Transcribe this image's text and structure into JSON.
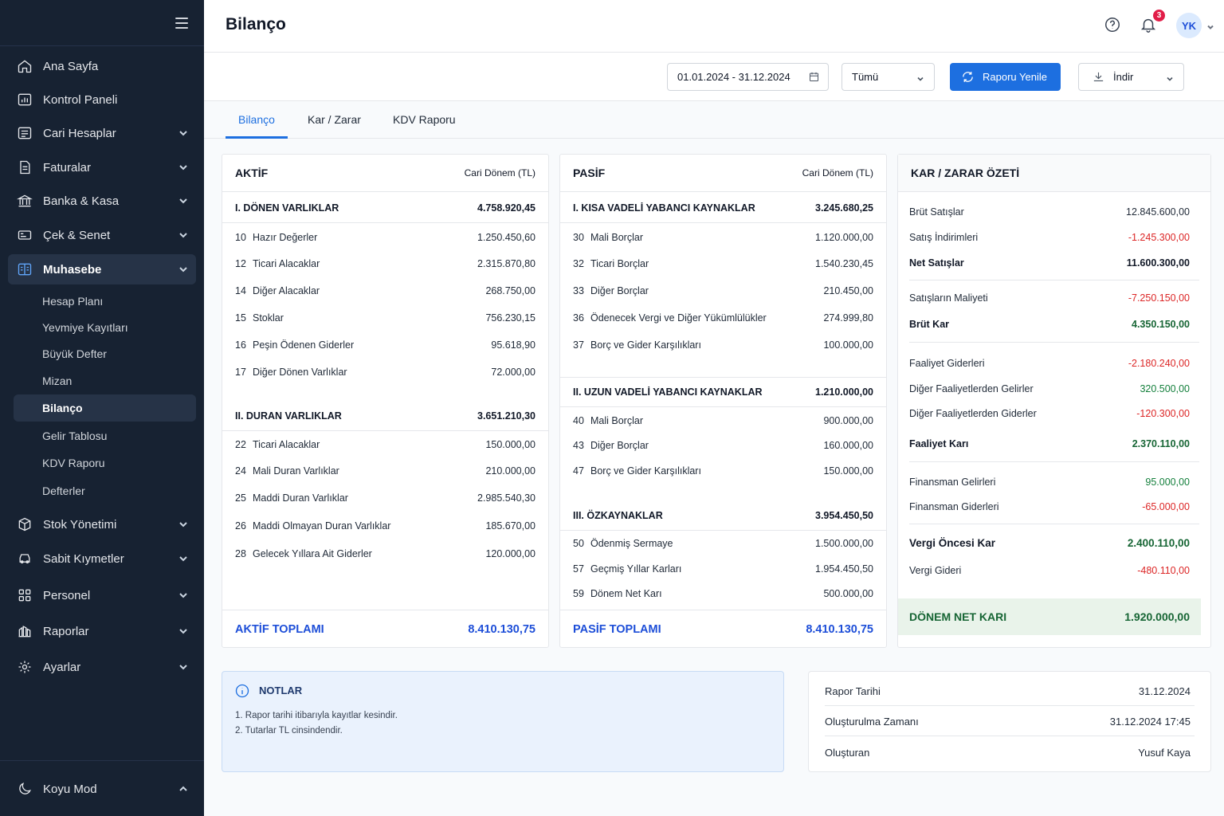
{
  "sidebar": {
    "items": [
      {
        "label": "Ana Sayfa",
        "icon": "home-icon"
      },
      {
        "label": "Kontrol Paneli",
        "icon": "dashboard-icon"
      },
      {
        "label": "Cari Hesaplar",
        "icon": "accounts-icon"
      },
      {
        "label": "Faturalar",
        "icon": "invoice-icon"
      },
      {
        "label": "Banka & Kasa",
        "icon": "bank-icon"
      },
      {
        "label": "Çek & Senet",
        "icon": "check-icon"
      },
      {
        "label": "Muhasebe",
        "icon": "ledger-icon"
      },
      {
        "label": "Stok Yönetimi",
        "icon": "box-icon"
      },
      {
        "label": "Sabit Kıymetler",
        "icon": "car-icon"
      },
      {
        "label": "Personel",
        "icon": "people-icon"
      },
      {
        "label": "Raporlar",
        "icon": "reports-icon"
      },
      {
        "label": "Ayarlar",
        "icon": "gear-icon"
      }
    ],
    "subitems": [
      "Hesap Planı",
      "Yevmiye Kayıtları",
      "Büyük Defter",
      "Mizan",
      "Bilanço",
      "Gelir Tablosu",
      "KDV Raporu",
      "Defterler"
    ],
    "dark_mode_label": "Koyu Mod"
  },
  "header": {
    "title": "Bilanço",
    "notification_count": "3",
    "avatar_initials": "YK"
  },
  "toolbar": {
    "date_range": "01.01.2024 - 31.12.2024",
    "filter_value": "Tümü",
    "refresh_label": "Raporu Yenile",
    "download_label": "İndir",
    "primary_color": "#1d6fe0"
  },
  "tabs": [
    "Bilanço",
    "Kar / Zarar",
    "KDV Raporu"
  ],
  "aktif": {
    "title": "AKTİF",
    "col": "Cari Dönem (TL)",
    "sections": [
      {
        "label": "I. DÖNEN VARLIKLAR",
        "total": "4.758.920,45",
        "rows": [
          {
            "code": "10",
            "name": "Hazır Değerler",
            "value": "1.250.450,60"
          },
          {
            "code": "12",
            "name": "Ticari Alacaklar",
            "value": "2.315.870,80"
          },
          {
            "code": "14",
            "name": "Diğer Alacaklar",
            "value": "268.750,00"
          },
          {
            "code": "15",
            "name": "Stoklar",
            "value": "756.230,15"
          },
          {
            "code": "16",
            "name": "Peşin Ödenen Giderler",
            "value": "95.618,90"
          },
          {
            "code": "17",
            "name": "Diğer Dönen Varlıklar",
            "value": "72.000,00"
          }
        ]
      },
      {
        "label": "II. DURAN VARLIKLAR",
        "total": "3.651.210,30",
        "rows": [
          {
            "code": "22",
            "name": "Ticari Alacaklar",
            "value": "150.000,00"
          },
          {
            "code": "24",
            "name": "Mali Duran Varlıklar",
            "value": "210.000,00"
          },
          {
            "code": "25",
            "name": "Maddi Duran Varlıklar",
            "value": "2.985.540,30"
          },
          {
            "code": "26",
            "name": "Maddi Olmayan Duran Varlıklar",
            "value": "185.670,00"
          },
          {
            "code": "28",
            "name": "Gelecek Yıllara Ait Giderler",
            "value": "120.000,00"
          }
        ]
      }
    ],
    "total_label": "AKTİF TOPLAMI",
    "total_value": "8.410.130,75"
  },
  "pasif": {
    "title": "PASİF",
    "col": "Cari Dönem (TL)",
    "sections": [
      {
        "label": "I. KISA VADELİ YABANCI KAYNAKLAR",
        "total": "3.245.680,25",
        "rows": [
          {
            "code": "30",
            "name": "Mali Borçlar",
            "value": "1.120.000,00"
          },
          {
            "code": "32",
            "name": "Ticari Borçlar",
            "value": "1.540.230,45"
          },
          {
            "code": "33",
            "name": "Diğer Borçlar",
            "value": "210.450,00"
          },
          {
            "code": "36",
            "name": "Ödenecek Vergi ve Diğer Yükümlülükler",
            "value": "274.999,80"
          },
          {
            "code": "37",
            "name": "Borç ve Gider Karşılıkları",
            "value": "100.000,00"
          }
        ]
      },
      {
        "label": "II. UZUN VADELİ YABANCI KAYNAKLAR",
        "total": "1.210.000,00",
        "rows": [
          {
            "code": "40",
            "name": "Mali Borçlar",
            "value": "900.000,00"
          },
          {
            "code": "43",
            "name": "Diğer Borçlar",
            "value": "160.000,00"
          },
          {
            "code": "47",
            "name": "Borç ve Gider Karşılıkları",
            "value": "150.000,00"
          }
        ]
      },
      {
        "label": "III. ÖZKAYNAKLAR",
        "total": "3.954.450,50",
        "rows": [
          {
            "code": "50",
            "name": "Ödenmiş Sermaye",
            "value": "1.500.000,00"
          },
          {
            "code": "57",
            "name": "Geçmiş Yıllar Karları",
            "value": "1.954.450,50"
          },
          {
            "code": "59",
            "name": "Dönem Net Karı",
            "value": "500.000,00"
          }
        ]
      }
    ],
    "total_label": "PASİF TOPLAMI",
    "total_value": "8.410.130,75"
  },
  "kz": {
    "title": "KAR / ZARAR ÖZETİ",
    "rows": [
      {
        "label": "Brüt Satışlar",
        "value": "12.845.600,00"
      },
      {
        "label": "Satış İndirimleri",
        "value": "-1.245.300,00"
      },
      {
        "label": "Net Satışlar",
        "value": "11.600.300,00"
      },
      {
        "label": "Satışların Maliyeti",
        "value": "-7.250.150,00"
      },
      {
        "label": "Brüt Kar",
        "value": "4.350.150,00"
      },
      {
        "label": "Faaliyet Giderleri",
        "value": "-2.180.240,00"
      },
      {
        "label": "Diğer Faaliyetlerden Gelirler",
        "value": "320.500,00"
      },
      {
        "label": "Diğer Faaliyetlerden Giderler",
        "value": "-120.300,00"
      },
      {
        "label": "Faaliyet Karı",
        "value": "2.370.110,00"
      },
      {
        "label": "Finansman Gelirleri",
        "value": "95.000,00"
      },
      {
        "label": "Finansman Giderleri",
        "value": "-65.000,00"
      },
      {
        "label": "Vergi Öncesi Kar",
        "value": "2.400.110,00"
      },
      {
        "label": "Vergi Gideri",
        "value": "-480.110,00"
      }
    ],
    "net_label": "DÖNEM NET KARI",
    "net_value": "1.920.000,00"
  },
  "notes": {
    "title": "NOTLAR",
    "items": [
      "1.  Rapor tarihi itibarıyla kayıtlar kesindir.",
      "2.  Tutarlar TL cinsindendir."
    ]
  },
  "info": {
    "rows": [
      {
        "label": "Rapor Tarihi",
        "value": "31.12.2024"
      },
      {
        "label": "Oluşturulma Zamanı",
        "value": "31.12.2024 17:45"
      },
      {
        "label": "Oluşturan",
        "value": "Yusuf Kaya"
      }
    ]
  }
}
